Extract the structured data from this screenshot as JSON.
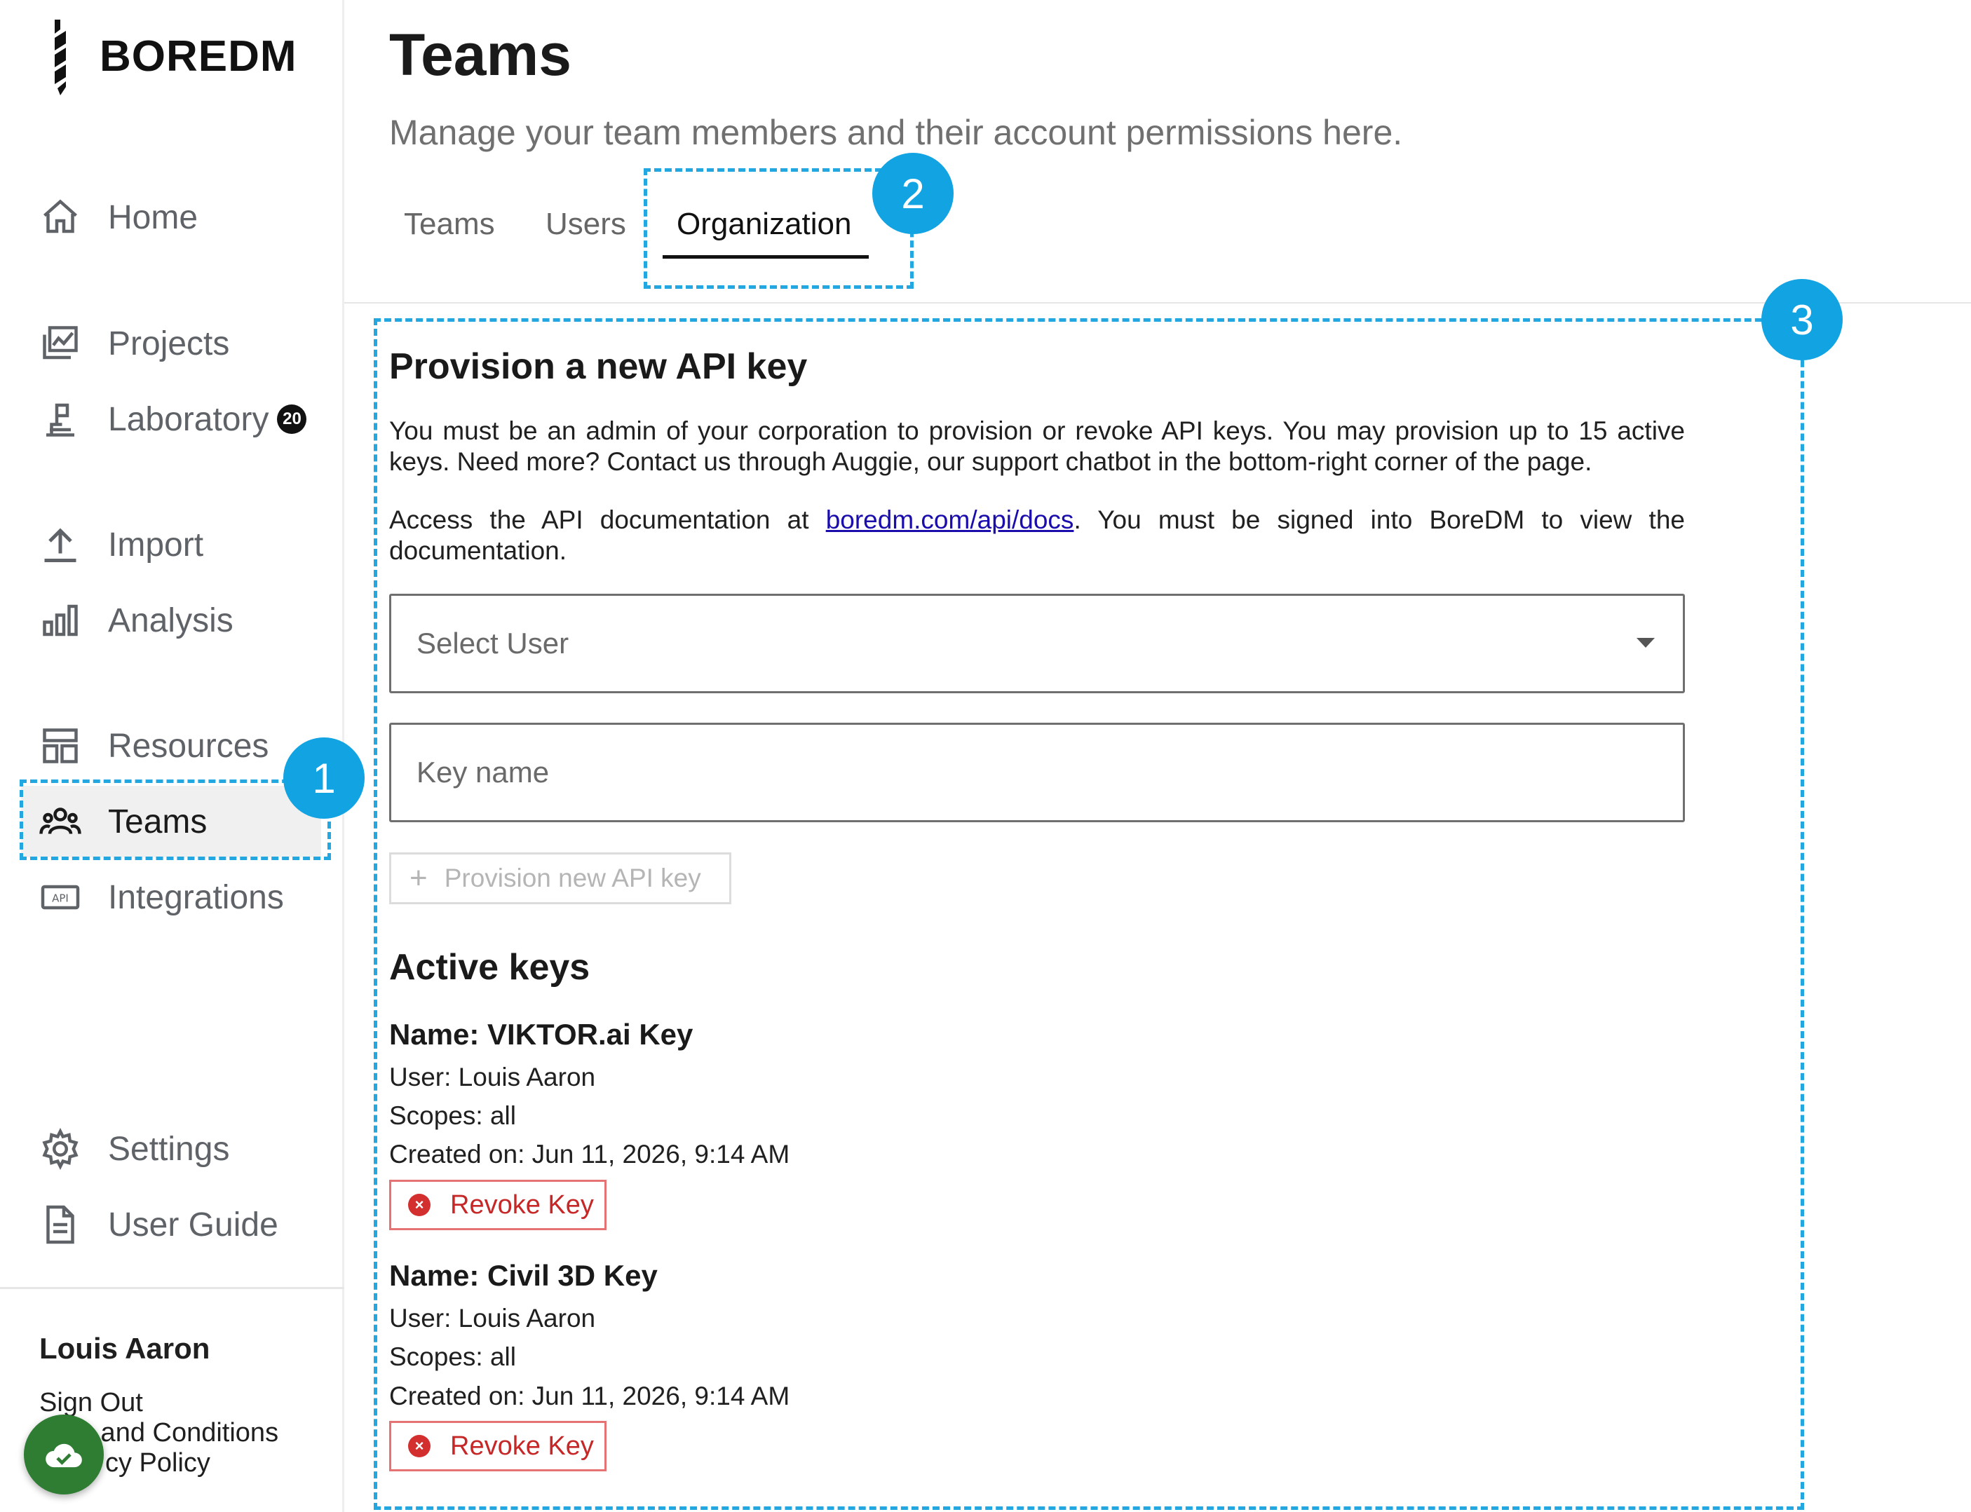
{
  "app": {
    "brand": "BOREDM",
    "brand_bold": "BORE",
    "brand_rest": "DM"
  },
  "sidebar": {
    "items": [
      {
        "label": "Home",
        "icon": "home-icon"
      },
      {
        "label": "Projects",
        "icon": "projects-icon"
      },
      {
        "label": "Laboratory",
        "icon": "laboratory-icon",
        "badge": "20"
      },
      {
        "label": "Import",
        "icon": "upload-icon"
      },
      {
        "label": "Analysis",
        "icon": "bar-chart-icon"
      },
      {
        "label": "Resources",
        "icon": "resources-icon"
      },
      {
        "label": "Teams",
        "icon": "people-icon",
        "active": true
      },
      {
        "label": "Integrations",
        "icon": "api-icon"
      },
      {
        "label": "Settings",
        "icon": "gear-icon"
      },
      {
        "label": "User Guide",
        "icon": "document-icon"
      }
    ],
    "user_name": "Louis Aaron",
    "footer_links": [
      "Sign Out",
      "s and Conditions",
      "cy Policy"
    ]
  },
  "header": {
    "title": "Teams",
    "subtitle": "Manage your team members and their account permissions here."
  },
  "tabs": [
    {
      "label": "Teams"
    },
    {
      "label": "Users"
    },
    {
      "label": "Organization",
      "active": true
    }
  ],
  "callouts": [
    "1",
    "2",
    "3"
  ],
  "provision": {
    "title": "Provision a new API key",
    "para1": "You must be an admin of your corporation to provision or revoke API keys. You may provision up to 15 active keys. Need more? Contact us through Auggie, our support chatbot in the bottom-right corner of the page.",
    "para2_prefix": "Access the API documentation at ",
    "para2_link": "boredm.com/api/docs",
    "para2_suffix": ". You must be signed into BoreDM to view the documentation.",
    "select_placeholder": "Select User",
    "key_name_placeholder": "Key name",
    "button_label": "Provision new API key"
  },
  "active_keys": {
    "title": "Active keys",
    "keys": [
      {
        "name": "Name: VIKTOR.ai Key",
        "user": "User: Louis Aaron",
        "scopes": "Scopes: all",
        "created": "Created on: Jun 11, 2026, 9:14 AM",
        "revoke_label": "Revoke Key"
      },
      {
        "name": "Name: Civil 3D Key",
        "user": "User: Louis Aaron",
        "scopes": "Scopes: all",
        "created": "Created on: Jun 11, 2026, 9:14 AM",
        "revoke_label": "Revoke Key"
      }
    ]
  },
  "colors": {
    "callout": "#12a3e3",
    "revoke": "#c62828",
    "fab": "#2e7d32"
  }
}
